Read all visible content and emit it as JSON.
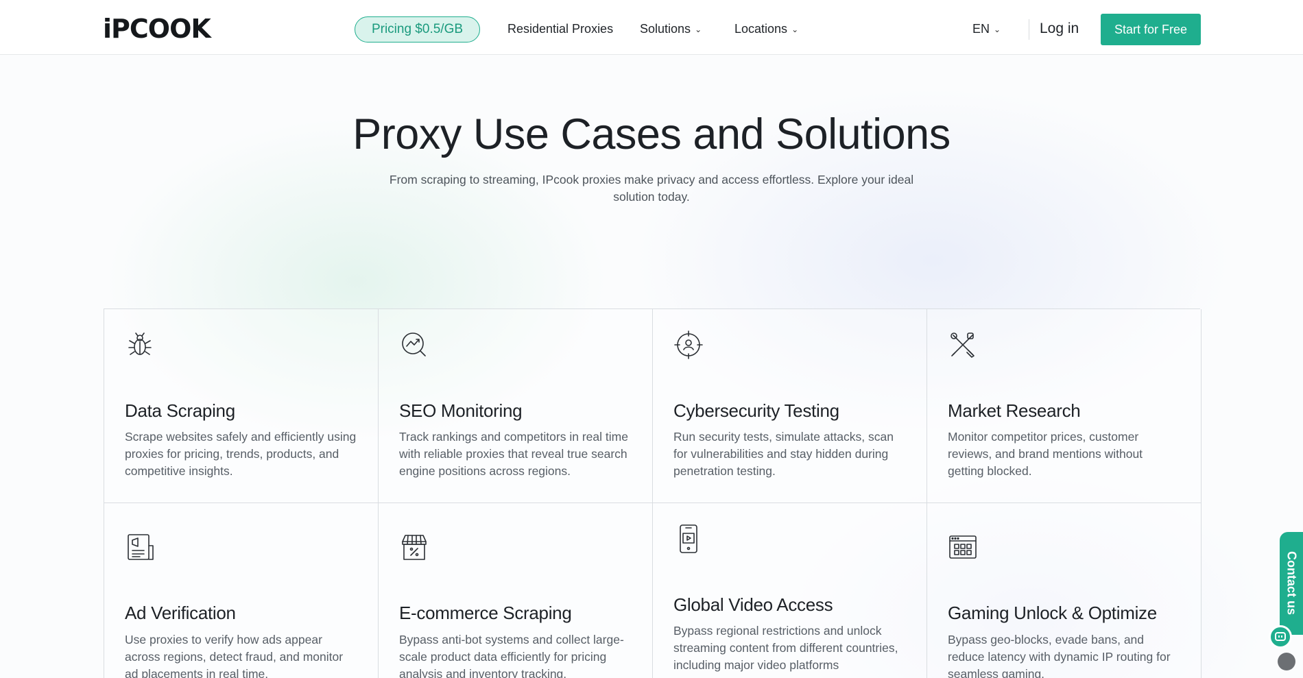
{
  "header": {
    "logo": "iPCOOK",
    "pricing": "Pricing $0.5/GB",
    "nav": [
      {
        "label": "Residential Proxies"
      },
      {
        "label": "Solutions"
      },
      {
        "label": "Locations"
      }
    ],
    "language": "EN",
    "login": "Log in",
    "cta": "Start for Free"
  },
  "hero": {
    "title": "Proxy Use Cases and Solutions",
    "subtitle_line1": "From scraping to streaming, IPcook proxies make privacy and access effortless. Explore your ideal",
    "subtitle_line2": "solution today."
  },
  "cards": [
    {
      "icon": "bug-icon",
      "title": "Data Scraping",
      "desc": "Scrape websites safely and efficiently using proxies for pricing, trends, products, and competitive insights."
    },
    {
      "icon": "chart-search-icon",
      "title": "SEO Monitoring",
      "desc": "Track rankings and competitors in real time with reliable proxies that reveal true search engine positions across regions."
    },
    {
      "icon": "target-user-icon",
      "title": "Cybersecurity Testing",
      "desc": "Run security tests, simulate attacks, scan for vulnerabilities and stay hidden during penetration testing."
    },
    {
      "icon": "tools-icon",
      "title": "Market Research",
      "desc": "Monitor competitor prices, customer reviews, and brand mentions without getting blocked."
    },
    {
      "icon": "ad-document-icon",
      "title": "Ad Verification",
      "desc": "Use proxies to verify how ads appear across regions, detect fraud, and monitor ad placements in real time."
    },
    {
      "icon": "store-discount-icon",
      "title": "E-commerce Scraping",
      "desc": "Bypass anti-bot systems and collect large-scale product data efficiently for pricing analysis and inventory tracking."
    },
    {
      "icon": "phone-video-icon",
      "title": "Global Video Access",
      "desc": "Bypass regional restrictions and unlock streaming content from different countries, including major video platforms"
    },
    {
      "icon": "game-window-icon",
      "title": "Gaming Unlock & Optimize",
      "desc": "Bypass geo-blocks, evade bans, and reduce latency with dynamic IP routing for seamless gaming."
    }
  ],
  "contact": {
    "label": "Contact us"
  },
  "colors": {
    "accent": "#1fae8e",
    "pill_bg": "#d9f3ec"
  }
}
